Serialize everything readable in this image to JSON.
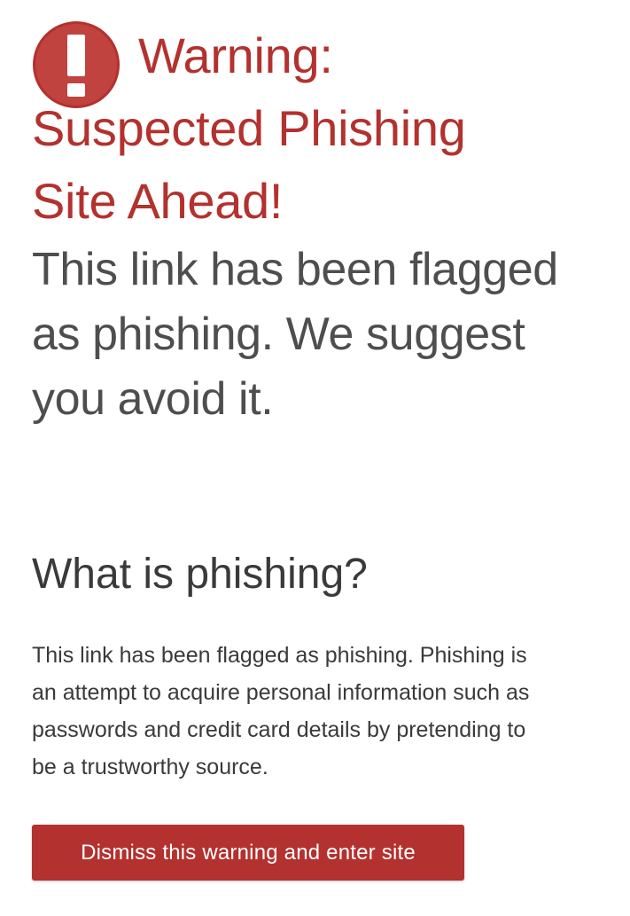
{
  "warning": {
    "icon": "exclamation-circle-icon",
    "line1": "Warning:",
    "line2": "Suspected Phishing",
    "line3": "Site Ahead!"
  },
  "lead": {
    "line1": "This link has been flagged",
    "line2": "as phishing. We suggest",
    "line3": "you avoid it."
  },
  "info": {
    "title": "What is phishing?",
    "line1": "This link has been flagged as phishing. Phishing is",
    "line2": "an attempt to acquire personal information such as",
    "line3": "passwords and credit card details by pretending to",
    "line4": "be a trustworthy source."
  },
  "actions": {
    "dismiss_label": "Dismiss this warning and enter site"
  },
  "colors": {
    "accent": "#b3312e",
    "lead_text": "#4e4e4e",
    "body_text": "#3a3a3a"
  }
}
